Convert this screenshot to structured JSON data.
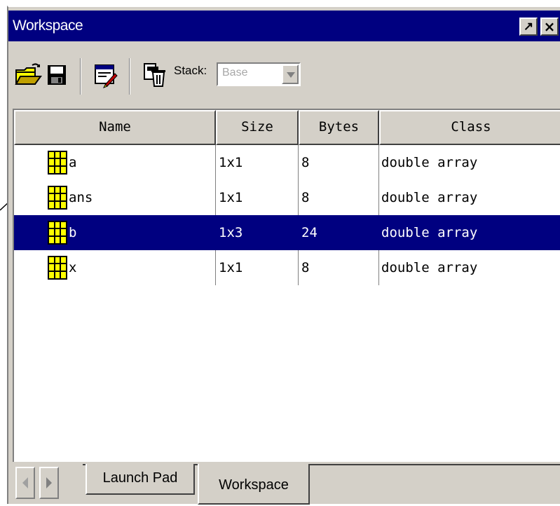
{
  "window": {
    "title": "Workspace",
    "undock_glyph": "↗",
    "close_glyph": "×"
  },
  "toolbar": {
    "icons": [
      "open-folder-icon",
      "save-disk-icon",
      "import-data-icon",
      "clear-workspace-icon"
    ],
    "stack_label": "Stack:",
    "stack_value": "Base"
  },
  "table": {
    "columns": [
      "Name",
      "Size",
      "Bytes",
      "Class"
    ],
    "rows": [
      {
        "name": "a",
        "size": "1x1",
        "bytes": "8",
        "class": "double array"
      },
      {
        "name": "ans",
        "size": "1x1",
        "bytes": "8",
        "class": "double array"
      },
      {
        "name": "b",
        "size": "1x3",
        "bytes": "24",
        "class": "double array"
      },
      {
        "name": "x",
        "size": "1x1",
        "bytes": "8",
        "class": "double array"
      }
    ],
    "selected_row": "b",
    "row_icon": "matrix-grid-icon"
  },
  "tabs": {
    "items": [
      "Launch Pad",
      "Workspace"
    ],
    "active": "Workspace"
  },
  "colors": {
    "titlebar": "#000080",
    "selection": "#000080",
    "face": "#d4d0c8",
    "matrix_icon": "#ffff00"
  }
}
